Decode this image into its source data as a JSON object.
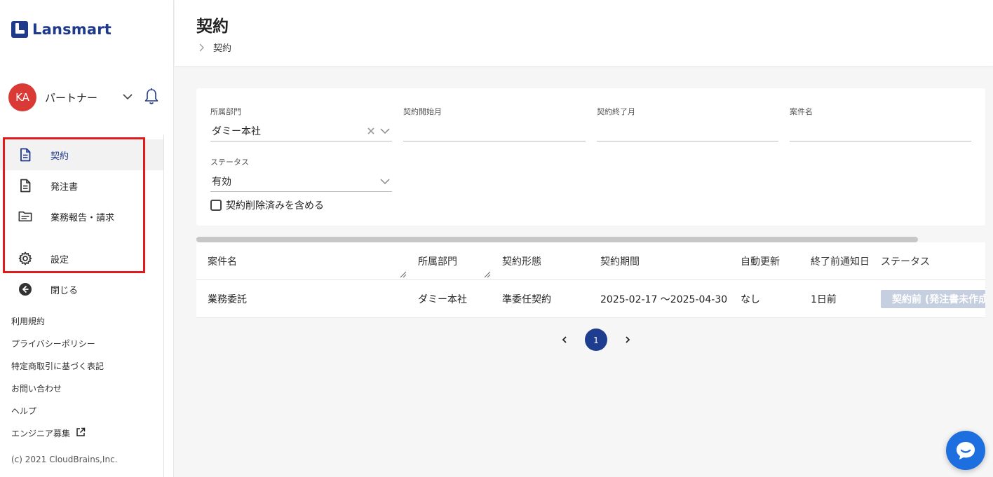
{
  "app": {
    "logo_text": "Lansmart"
  },
  "user": {
    "initials": "KA",
    "name": "パートナー"
  },
  "sidebar": {
    "items": [
      {
        "label": "契約",
        "icon": "document-icon",
        "active": true
      },
      {
        "label": "発注書",
        "icon": "document-icon",
        "active": false
      },
      {
        "label": "業務報告・請求",
        "icon": "folder-icon",
        "active": false
      },
      {
        "label": "設定",
        "icon": "gear-icon",
        "active": false
      },
      {
        "label": "閉じる",
        "icon": "arrow-left-circle-icon",
        "active": false
      }
    ],
    "footer_links": [
      "利用規約",
      "プライバシーポリシー",
      "特定商取引に基づく表記",
      "お問い合わせ",
      "ヘルプ",
      "エンジニア募集"
    ],
    "copyright": "(c) 2021 CloudBrains,Inc."
  },
  "header": {
    "title": "契約",
    "breadcrumb": [
      "契約"
    ]
  },
  "filters": {
    "department": {
      "label": "所属部門",
      "value": "ダミー本社"
    },
    "start_month": {
      "label": "契約開始月",
      "value": ""
    },
    "end_month": {
      "label": "契約終了月",
      "value": ""
    },
    "project_name": {
      "label": "案件名",
      "value": ""
    },
    "status": {
      "label": "ステータス",
      "value": "有効"
    },
    "include_deleted": {
      "label": "契約削除済みを含める",
      "checked": false
    }
  },
  "table": {
    "columns": [
      "案件名",
      "所属部門",
      "契約形態",
      "契約期間",
      "自動更新",
      "終了前通知日",
      "ステータス"
    ],
    "rows": [
      {
        "project": "業務委託",
        "department": "ダミー本社",
        "type": "準委任契約",
        "period": "2025-02-17 〜2025-04-30",
        "auto_renew": "なし",
        "notice": "1日前",
        "status": "契約前 (発注書未作成)"
      }
    ]
  },
  "pagination": {
    "current": "1"
  },
  "colors": {
    "brand": "#1f3a8a",
    "avatar": "#d93a36",
    "highlight": "#e01b1b",
    "chat": "#1d6fe0",
    "badge": "#c6cfe0"
  }
}
